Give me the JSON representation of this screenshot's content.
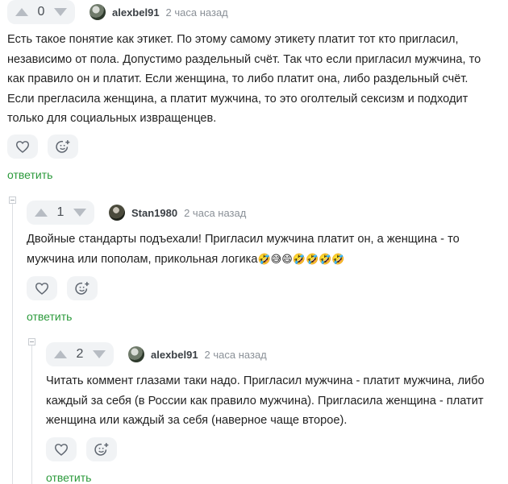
{
  "comments": [
    {
      "score": "0",
      "author": "alexbel91",
      "time": "2 часа назад",
      "text": "Есть такое понятие как этикет. По этому самому этикету платит тот кто пригласил, независимо от пола. Допустимо раздельный счёт. Так что если пригласил мужчина, то как правило он и платит. Если женщина, то либо платит она, либо раздельный счёт. Если прегласила женщина, а платит мужчина, то это оголтелый сексизм и подходит только для социальных извращенцев.",
      "reply": "ответить"
    },
    {
      "score": "1",
      "author": "Stan1980",
      "time": "2 часа назад",
      "text": "Двойные стандарты подъехали! Пригласил мужчина платит он, а женщина - то мужчина или пополам, прикольная логика",
      "emojis": "🤣😅😄🤣🤣🤣🤣",
      "reply": "ответить"
    },
    {
      "score": "2",
      "author": "alexbel91",
      "time": "2 часа назад",
      "text": "Читать коммент глазами таки надо. Пригласил мужчина - платит мужчина, либо каждый за себя (в России как правило мужчина). Пригласила женщина - платит женщина или каждый за себя (наверное чаще второе).",
      "reply": "ответить"
    }
  ],
  "icons": {
    "upvote": "triangle-up-icon",
    "downvote": "triangle-down-icon",
    "like": "heart-icon",
    "react": "smiley-plus-icon",
    "collapse": "collapse-minus-icon"
  },
  "colors": {
    "reply_link": "#2b9a3b",
    "vote_bg": "#f1f3f5"
  }
}
